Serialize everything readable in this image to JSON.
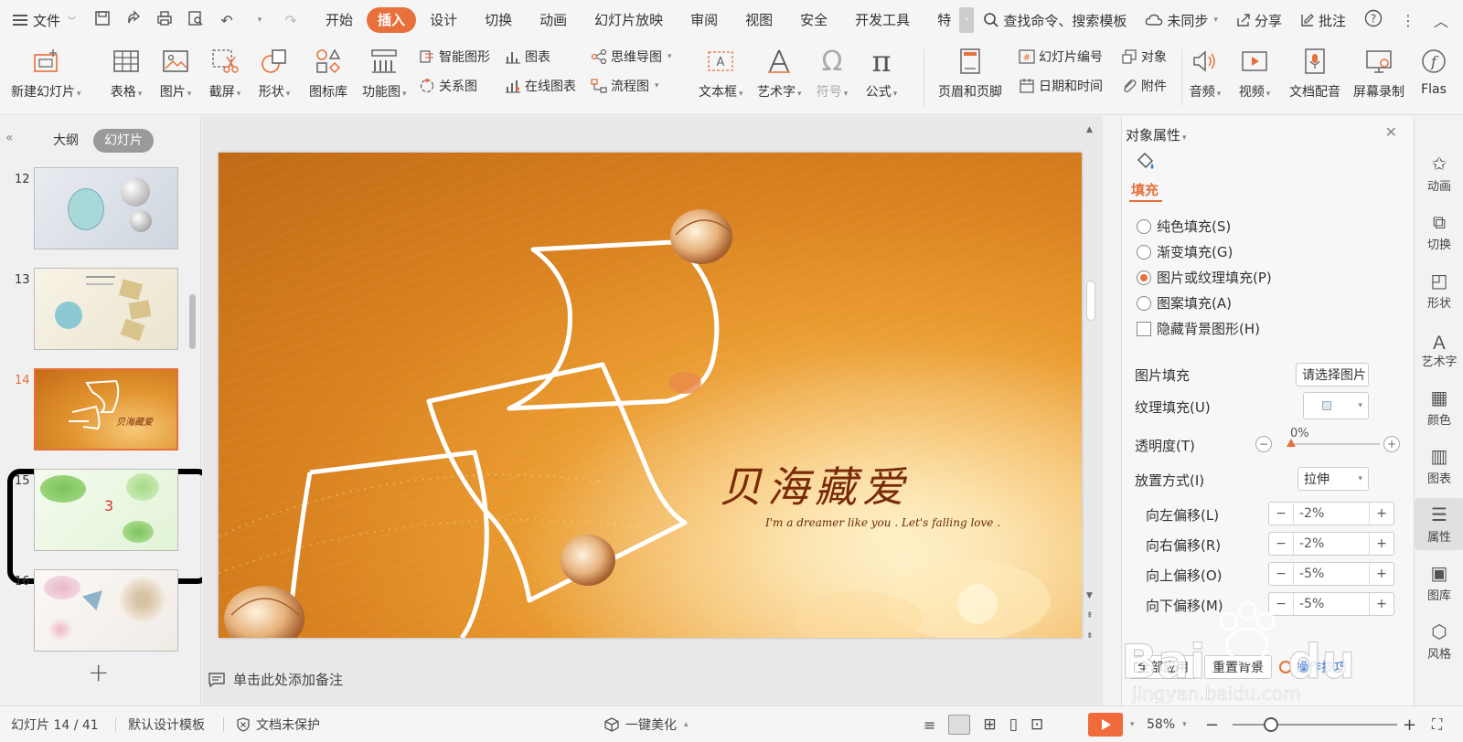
{
  "menubar": {
    "file_label": "文件",
    "tabs": [
      "开始",
      "插入",
      "设计",
      "切换",
      "动画",
      "幻灯片放映",
      "审阅",
      "视图",
      "安全",
      "开发工具",
      "特"
    ],
    "active_tab": "插入",
    "search_label": "查找命令、搜索模板",
    "sync_label": "未同步",
    "share_label": "分享",
    "comment_label": "批注"
  },
  "ribbon": {
    "new_slide": "新建幻灯片",
    "table": "表格",
    "picture": "图片",
    "screenshot": "截屏",
    "shape": "形状",
    "icon_lib": "图标库",
    "function_chart": "功能图",
    "smart_art": "智能图形",
    "chart": "图表",
    "mind_map": "思维导图",
    "relation": "关系图",
    "online_chart": "在线图表",
    "flowchart": "流程图",
    "textbox": "文本框",
    "wordart": "艺术字",
    "symbol": "符号",
    "formula": "公式",
    "header_footer": "页眉和页脚",
    "slide_number": "幻灯片编号",
    "object": "对象",
    "date_time": "日期和时间",
    "attachment": "附件",
    "audio": "音频",
    "video": "视频",
    "voiceover": "文档配音",
    "screen_record": "屏幕录制",
    "flash": "Flas"
  },
  "left_panel": {
    "tab_outline": "大纲",
    "tab_slides": "幻灯片",
    "thumbs": [
      {
        "num": "12"
      },
      {
        "num": "13"
      },
      {
        "num": "14"
      },
      {
        "num": "15"
      },
      {
        "num": "16"
      }
    ],
    "current": "14"
  },
  "slide": {
    "title": "贝海藏爱",
    "subtitle": "I'm a dreamer like you . Let's falling love ."
  },
  "notes_placeholder": "单击此处添加备注",
  "properties": {
    "title": "对象属性",
    "fill_tab": "填充",
    "options": [
      {
        "label": "纯色填充(S)",
        "selected": false
      },
      {
        "label": "渐变填充(G)",
        "selected": false
      },
      {
        "label": "图片或纹理填充(P)",
        "selected": true
      },
      {
        "label": "图案填充(A)",
        "selected": false
      }
    ],
    "hide_bg": "隐藏背景图形(H)",
    "picture_fill_label": "图片填充",
    "picture_fill_btn": "请选择图片",
    "texture_fill_label": "纹理填充(U)",
    "transparency_label": "透明度(T)",
    "transparency_value": "0%",
    "placement_label": "放置方式(I)",
    "placement_value": "拉伸",
    "offsets": [
      {
        "label": "向左偏移(L)",
        "value": "-2%"
      },
      {
        "label": "向右偏移(R)",
        "value": "-2%"
      },
      {
        "label": "向上偏移(O)",
        "value": "-5%"
      },
      {
        "label": "向下偏移(M)",
        "value": "-5%"
      }
    ],
    "apply_all": "全部应用",
    "reset_bg": "重置背景",
    "tips": "操作技巧"
  },
  "right_strip": [
    "动画",
    "切换",
    "形状",
    "艺术字",
    "颜色",
    "图表",
    "属性",
    "图库",
    "风格"
  ],
  "statusbar": {
    "slide_counter": "幻灯片 14 / 41",
    "template": "默认设计模板",
    "protect": "文档未保护",
    "beautify": "一键美化",
    "zoom": "58%"
  },
  "colors": {
    "accent": "#e8703a",
    "play": "#f06a3c"
  }
}
